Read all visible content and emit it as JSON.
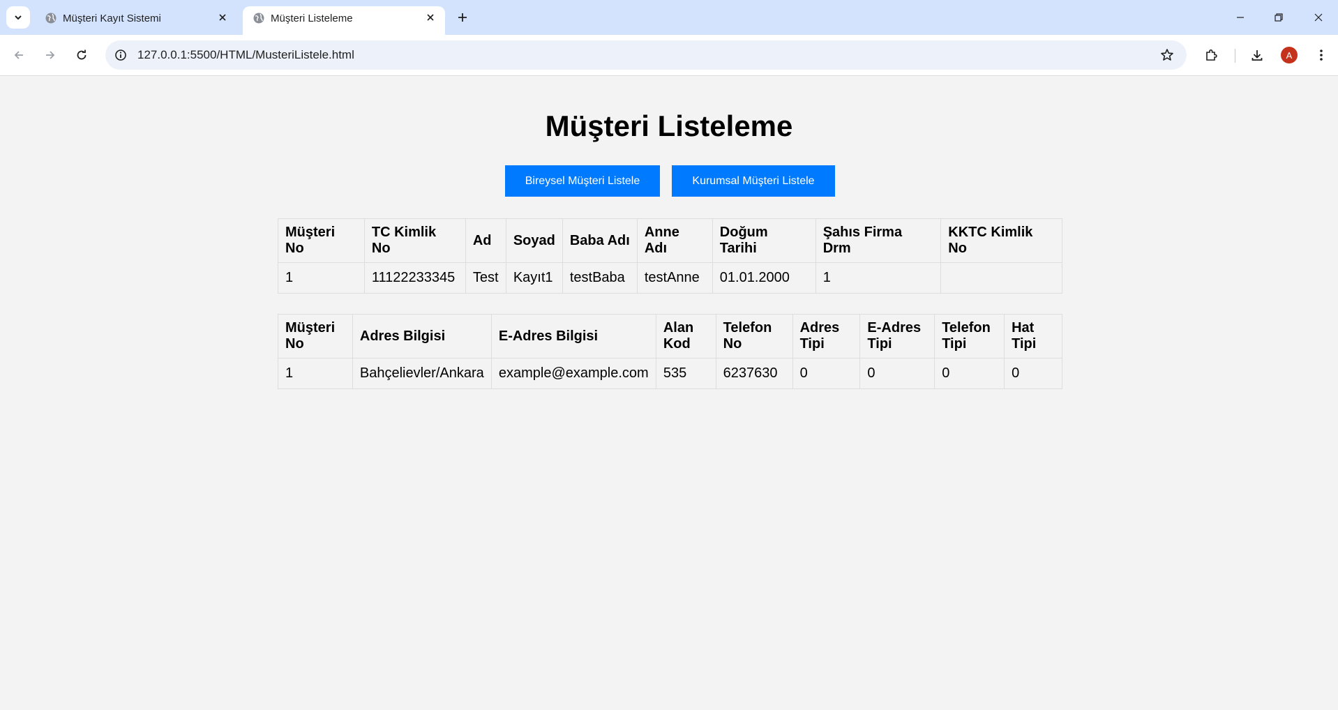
{
  "browser": {
    "tabs": [
      {
        "title": "Müşteri Kayıt Sistemi",
        "active": false
      },
      {
        "title": "Müşteri Listeleme",
        "active": true
      }
    ],
    "url": "127.0.0.1:5500/HTML/MusteriListele.html",
    "profile_initial": "A",
    "icons": {
      "tab_search": "chevron-down-icon",
      "favicon": "globe-icon",
      "close": "close-icon",
      "new_tab": "plus-icon",
      "back": "arrow-left-icon",
      "forward": "arrow-right-icon",
      "reload": "reload-icon",
      "site_info": "info-icon",
      "bookmark": "star-icon",
      "extensions": "puzzle-icon",
      "downloads": "download-icon",
      "menu": "kebab-menu-icon",
      "minimize": "minimize-icon",
      "restore": "restore-icon",
      "window_close": "window-close-icon"
    },
    "colors": {
      "tabstrip": "#d3e3fd",
      "omnibox": "#edf2fa",
      "avatar": "#c5321b"
    }
  },
  "page": {
    "title": "Müşteri Listeleme",
    "buttons": {
      "bireysel": "Bireysel Müşteri Listele",
      "kurumsal": "Kurumsal Müşteri Listele"
    },
    "colors": {
      "button": "#007bff",
      "background": "#f3f3f3",
      "border": "#dddddd"
    }
  },
  "musteri_table": {
    "headers": [
      "Müşteri No",
      "TC Kimlik No",
      "Ad",
      "Soyad",
      "Baba Adı",
      "Anne Adı",
      "Doğum Tarihi",
      "Şahıs Firma Drm",
      "KKTC Kimlik No"
    ],
    "rows": [
      [
        "1",
        "11122233345",
        "Test",
        "Kayıt1",
        "testBaba",
        "testAnne",
        "01.01.2000",
        "1",
        ""
      ]
    ]
  },
  "adres_table": {
    "headers": [
      "Müşteri No",
      "Adres Bilgisi",
      "E-Adres Bilgisi",
      "Alan Kod",
      "Telefon No",
      "Adres Tipi",
      "E-Adres Tipi",
      "Telefon Tipi",
      "Hat Tipi"
    ],
    "rows": [
      [
        "1",
        "Bahçelievler/Ankara",
        "example@example.com",
        "535",
        "6237630",
        "0",
        "0",
        "0",
        "0"
      ]
    ]
  }
}
